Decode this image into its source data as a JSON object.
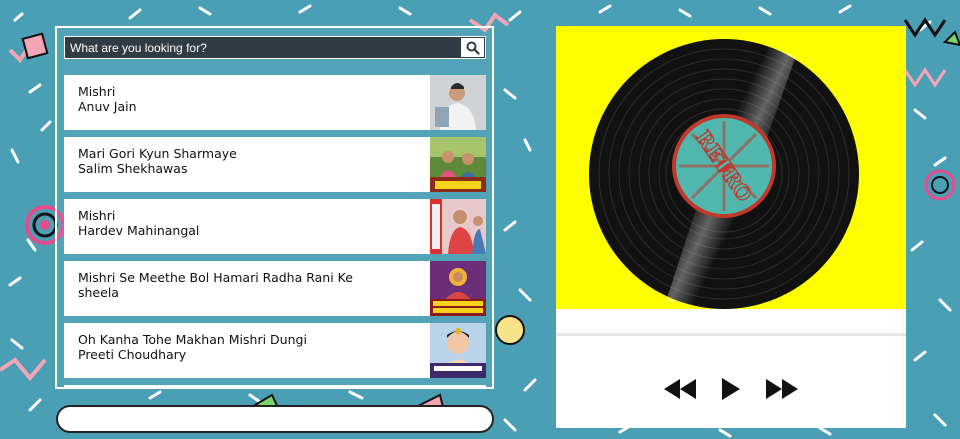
{
  "search": {
    "placeholder": "What are you looking for?"
  },
  "results": [
    {
      "title": "Mishri",
      "artist": "Anuv Jain"
    },
    {
      "title": "Mari Gori Kyun Sharmaye",
      "artist": "Salim Shekhawas"
    },
    {
      "title": "Mishri",
      "artist": "Hardev Mahinangal"
    },
    {
      "title": "Mishri Se Meethe Bol Hamari Radha Rani Ke",
      "artist": "sheela"
    },
    {
      "title": "Oh Kanha Tohe Makhan Mishri Dungi",
      "artist": "Preeti Choudhary"
    }
  ],
  "player": {
    "record_label": "RETRO"
  },
  "icons": {
    "search": "search-icon",
    "prev": "rewind-icon",
    "play": "play-icon",
    "next": "fast-forward-icon"
  },
  "colors": {
    "background": "#4a9fb5",
    "art_background": "#ffff00",
    "record_label": "#4fb7ae",
    "label_text": "#c0392b"
  }
}
